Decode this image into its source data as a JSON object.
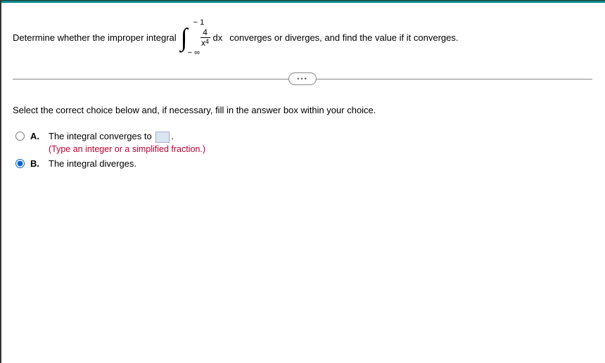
{
  "question": {
    "prefix": "Determine whether the improper integral",
    "integral": {
      "upper": "− 1",
      "lower": "− ∞",
      "numerator": "4",
      "denom_base": "x",
      "denom_exp": "4",
      "dx": "dx"
    },
    "suffix": "converges or diverges, and find the value if it converges."
  },
  "expand_label": "•••",
  "instruction": "Select the correct choice below and, if necessary, fill in the answer box within your choice.",
  "choices": {
    "A": {
      "letter": "A.",
      "text_before": "The integral converges to",
      "text_after": ".",
      "hint": "(Type an integer or a simplified fraction.)",
      "selected": false
    },
    "B": {
      "letter": "B.",
      "text": "The integral diverges.",
      "selected": true
    }
  }
}
